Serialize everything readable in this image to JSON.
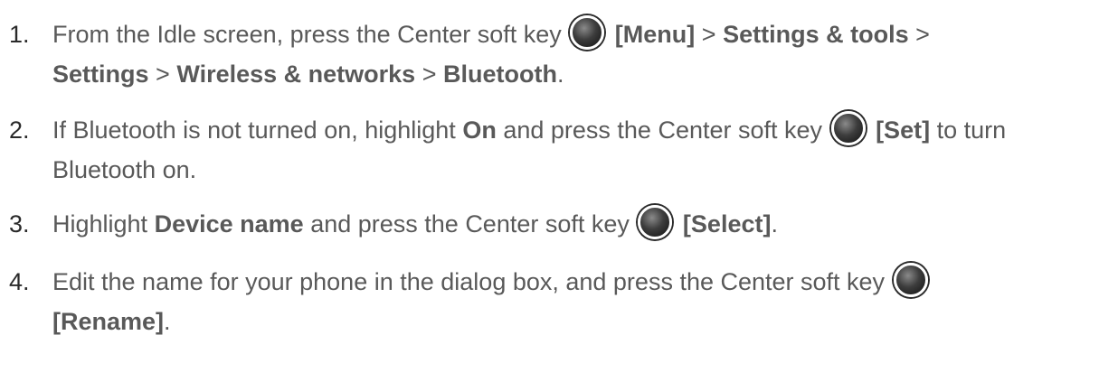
{
  "steps": [
    {
      "number": "1.",
      "p1": "From the Idle screen, press the Center soft key",
      "b1": "[Menu]",
      "sep1": ">",
      "b2": "Settings & tools",
      "sep2": ">",
      "b3": "Settings",
      "sep3": ">",
      "b4": "Wireless & networks",
      "sep4": ">",
      "b5": "Bluetooth",
      "end": "."
    },
    {
      "number": "2.",
      "p1": "If Bluetooth is not turned on, highlight",
      "b1": "On",
      "p2": "and press the Center soft key",
      "b2": "[Set]",
      "p3": "to turn",
      "p4": "Bluetooth on."
    },
    {
      "number": "3.",
      "p1": "Highlight",
      "b1": "Device name",
      "p2": "and press the Center soft key",
      "b2": "[Select]",
      "end": "."
    },
    {
      "number": "4.",
      "p1": "Edit the name for your phone in the dialog box, and press the Center soft key",
      "b1": "[Rename]",
      "end": "."
    }
  ],
  "icons": {
    "center_key": "center-soft-key-icon"
  }
}
